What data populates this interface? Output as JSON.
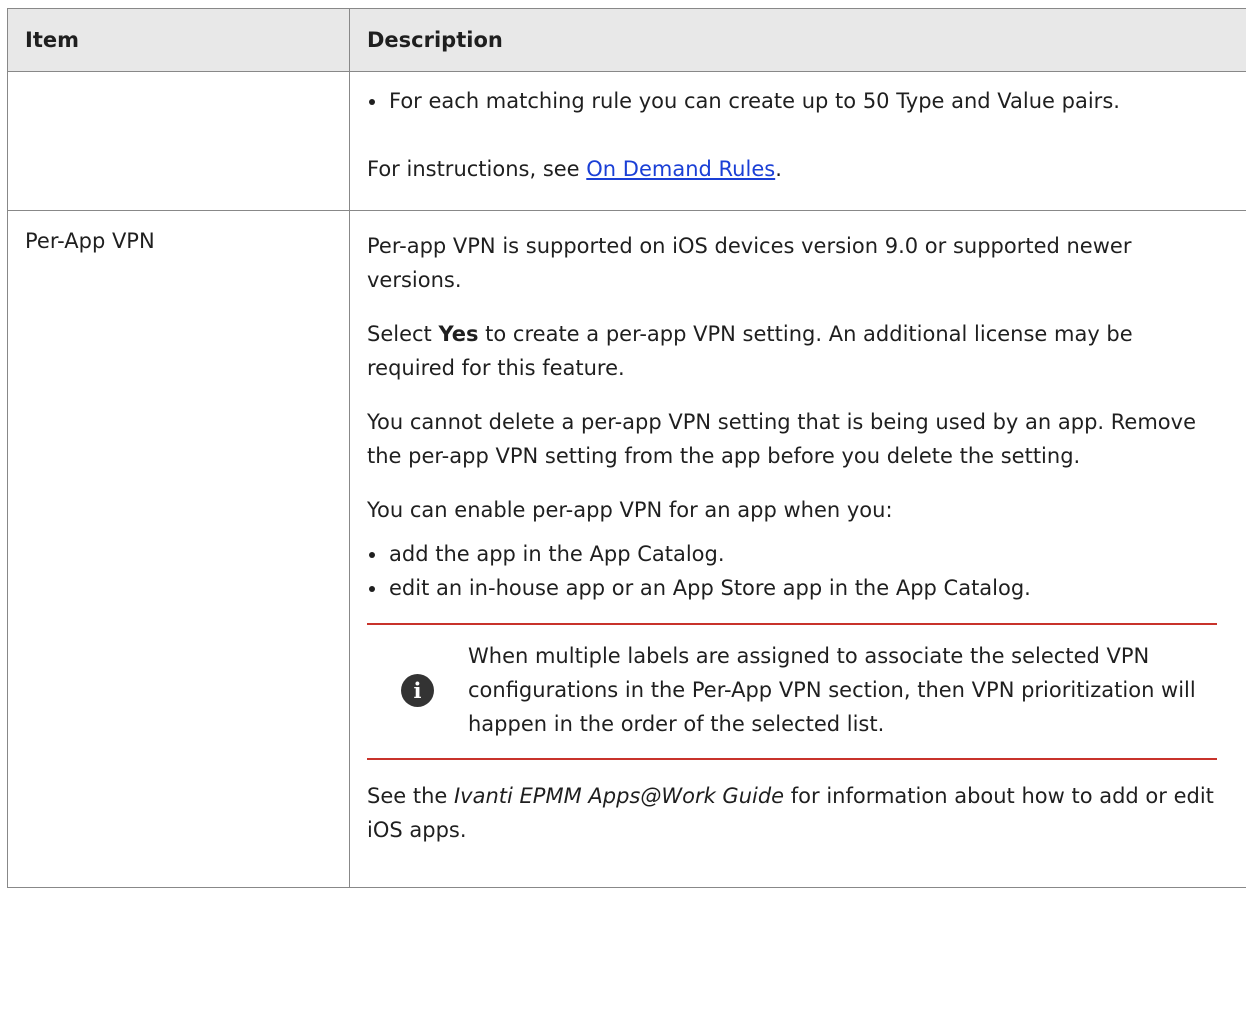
{
  "table": {
    "header_item": "Item",
    "header_description": "Description"
  },
  "row_continued": {
    "bullet": "For each matching rule you can create up to 50 Type and Value pairs.",
    "instructions_prefix": "For instructions, see ",
    "instructions_link": "On Demand Rules",
    "instructions_suffix": "."
  },
  "row_per_app": {
    "item": "Per-App VPN",
    "para1": "Per-app VPN is supported on iOS devices version 9.0 or supported newer versions.",
    "para2_prefix": "Select ",
    "para2_bold": "Yes",
    "para2_suffix": " to create a per-app VPN setting. An additional license may be required for this feature.",
    "para3": "You cannot delete a per-app VPN setting that is being used by an app. Remove the per-app VPN setting from the app before you delete the setting.",
    "para4": "You can enable per-app VPN for an app when you:",
    "bullets": [
      "add the app in the App Catalog.",
      "edit an in-house app or an App Store app in the App Catalog."
    ],
    "note_icon_glyph": "i",
    "note_text": "When multiple labels are assigned to associate the selected VPN configurations in the Per-App VPN section, then VPN prioritization will happen in the order of the selected list.",
    "para5_prefix": "See the ",
    "para5_italic": "Ivanti EPMM Apps@Work Guide",
    "para5_suffix": " for information about how to add or edit iOS apps."
  },
  "colors": {
    "header_bg": "#e8e8e8",
    "border": "#888888",
    "note_rule": "#c8332b",
    "link": "#1a3fd6",
    "note_icon_bg": "#333333"
  }
}
